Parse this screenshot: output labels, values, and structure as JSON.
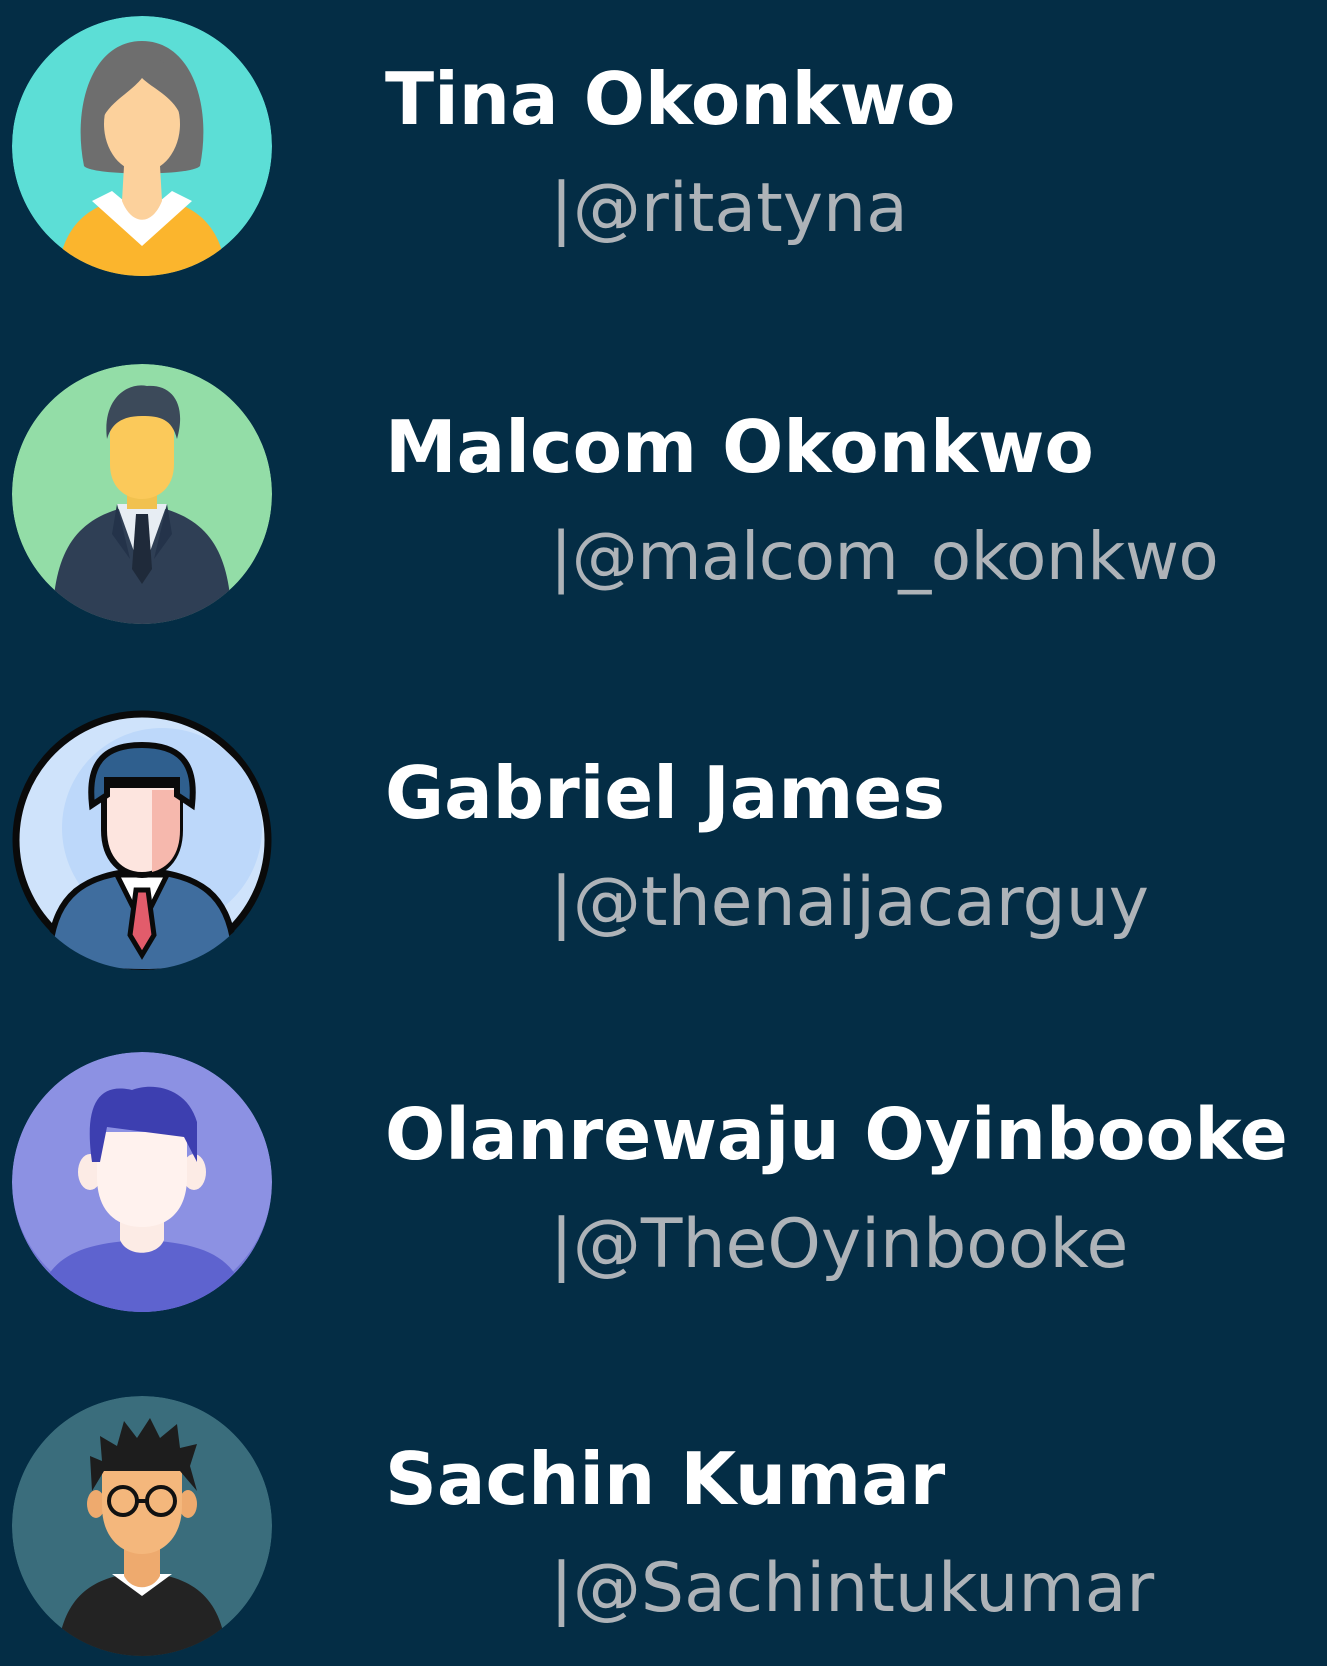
{
  "users": [
    {
      "name": "Tina Okonkwo",
      "handle": "|@ritatyna",
      "avatar_icon": "woman-avatar-icon",
      "avatar_color": "#5cded6"
    },
    {
      "name": "Malcom Okonkwo",
      "handle": "|@malcom_okonkwo",
      "avatar_icon": "businessman-avatar-icon",
      "avatar_color": "#93dda7"
    },
    {
      "name": "Gabriel James",
      "handle": "|@thenaijacarguy",
      "avatar_icon": "man-suit-avatar-icon",
      "avatar_color": "#cfe3fb"
    },
    {
      "name": "Olanrewaju Oyinbooke",
      "handle": "|@TheOyinbooke",
      "avatar_icon": "man-avatar-icon",
      "avatar_color": "#8c91e3"
    },
    {
      "name": "Sachin Kumar",
      "handle": "|@Sachintukumar",
      "avatar_icon": "man-glasses-avatar-icon",
      "avatar_color": "#3a6d7c"
    }
  ],
  "colors": {
    "background": "#042d45",
    "name_text": "#ffffff",
    "handle_text": "#aeb3b8"
  }
}
